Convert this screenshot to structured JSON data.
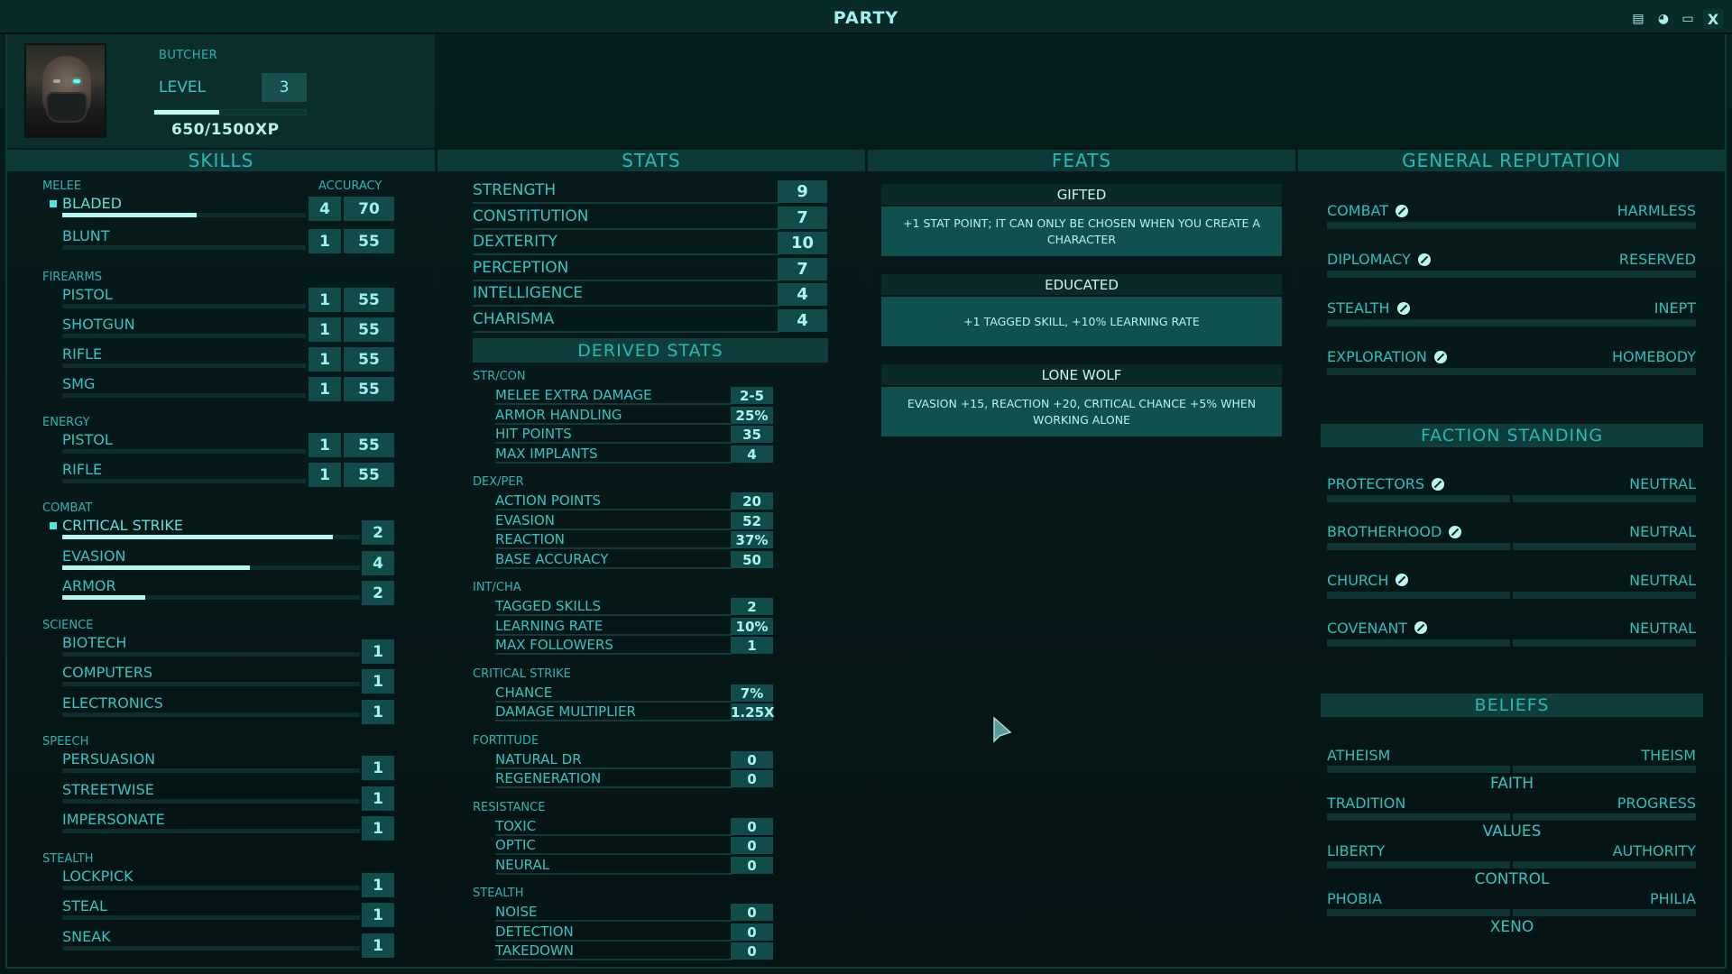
{
  "window": {
    "title": "PARTY",
    "buttons": [
      {
        "name": "inventory-icon",
        "glyph": "▤"
      },
      {
        "name": "character-head-icon",
        "glyph": "◕"
      },
      {
        "name": "monitor-icon",
        "glyph": "▭"
      },
      {
        "name": "close-icon",
        "glyph": "X"
      }
    ]
  },
  "character": {
    "name": "BUTCHER",
    "level_label": "LEVEL",
    "level": "3",
    "xp_current": 650,
    "xp_max": 1500,
    "xp_text": "650/1500XP",
    "xp_fraction": 0.43
  },
  "columns": {
    "skills": "SKILLS",
    "stats": "STATS",
    "feats": "FEATS",
    "reputation": "GENERAL REPUTATION"
  },
  "skills": {
    "accuracy_label": "ACCURACY",
    "groups": [
      {
        "label": "MELEE",
        "items": [
          {
            "name": "BLADED",
            "tagged": true,
            "level": "4",
            "accuracy": "70",
            "progress": 0.55
          },
          {
            "name": "BLUNT",
            "tagged": false,
            "level": "1",
            "accuracy": "55",
            "progress": 0
          }
        ]
      },
      {
        "label": "FIREARMS",
        "items": [
          {
            "name": "PISTOL",
            "tagged": false,
            "level": "1",
            "accuracy": "55",
            "progress": 0
          },
          {
            "name": "SHOTGUN",
            "tagged": false,
            "level": "1",
            "accuracy": "55",
            "progress": 0
          },
          {
            "name": "RIFLE",
            "tagged": false,
            "level": "1",
            "accuracy": "55",
            "progress": 0
          },
          {
            "name": "SMG",
            "tagged": false,
            "level": "1",
            "accuracy": "55",
            "progress": 0
          }
        ]
      },
      {
        "label": "ENERGY",
        "items": [
          {
            "name": "PISTOL",
            "tagged": false,
            "level": "1",
            "accuracy": "55",
            "progress": 0
          },
          {
            "name": "RIFLE",
            "tagged": false,
            "level": "1",
            "accuracy": "55",
            "progress": 0
          }
        ]
      },
      {
        "label": "COMBAT",
        "items": [
          {
            "name": "CRITICAL STRIKE",
            "tagged": true,
            "level": "2",
            "progress": 0.91
          },
          {
            "name": "EVASION",
            "tagged": false,
            "level": "4",
            "progress": 0.63
          },
          {
            "name": "ARMOR",
            "tagged": false,
            "level": "2",
            "progress": 0.28
          }
        ]
      },
      {
        "label": "SCIENCE",
        "items": [
          {
            "name": "BIOTECH",
            "tagged": false,
            "level": "1",
            "progress": 0
          },
          {
            "name": "COMPUTERS",
            "tagged": false,
            "level": "1",
            "progress": 0
          },
          {
            "name": "ELECTRONICS",
            "tagged": false,
            "level": "1",
            "progress": 0
          }
        ]
      },
      {
        "label": "SPEECH",
        "items": [
          {
            "name": "PERSUASION",
            "tagged": false,
            "level": "1",
            "progress": 0
          },
          {
            "name": "STREETWISE",
            "tagged": false,
            "level": "1",
            "progress": 0
          },
          {
            "name": "IMPERSONATE",
            "tagged": false,
            "level": "1",
            "progress": 0
          }
        ]
      },
      {
        "label": "STEALTH",
        "items": [
          {
            "name": "LOCKPICK",
            "tagged": false,
            "level": "1",
            "progress": 0
          },
          {
            "name": "STEAL",
            "tagged": false,
            "level": "1",
            "progress": 0
          },
          {
            "name": "SNEAK",
            "tagged": false,
            "level": "1",
            "progress": 0
          }
        ]
      }
    ]
  },
  "stats": {
    "primary": [
      {
        "name": "STRENGTH",
        "value": "9"
      },
      {
        "name": "CONSTITUTION",
        "value": "7"
      },
      {
        "name": "DEXTERITY",
        "value": "10"
      },
      {
        "name": "PERCEPTION",
        "value": "7"
      },
      {
        "name": "INTELLIGENCE",
        "value": "4"
      },
      {
        "name": "CHARISMA",
        "value": "4"
      }
    ],
    "derived_title": "DERIVED STATS",
    "derived_groups": [
      {
        "label": "STR/CON",
        "items": [
          {
            "name": "MELEE EXTRA DAMAGE",
            "value": "2-5"
          },
          {
            "name": "ARMOR HANDLING",
            "value": "25%"
          },
          {
            "name": "HIT POINTS",
            "value": "35"
          },
          {
            "name": "MAX IMPLANTS",
            "value": "4"
          }
        ]
      },
      {
        "label": "DEX/PER",
        "items": [
          {
            "name": "ACTION POINTS",
            "value": "20"
          },
          {
            "name": "EVASION",
            "value": "52"
          },
          {
            "name": "REACTION",
            "value": "37%"
          },
          {
            "name": "BASE ACCURACY",
            "value": "50"
          }
        ]
      },
      {
        "label": "INT/CHA",
        "items": [
          {
            "name": "TAGGED SKILLS",
            "value": "2"
          },
          {
            "name": "LEARNING RATE",
            "value": "10%"
          },
          {
            "name": "MAX FOLLOWERS",
            "value": "1"
          }
        ]
      },
      {
        "label": "CRITICAL STRIKE",
        "items": [
          {
            "name": "CHANCE",
            "value": "7%"
          },
          {
            "name": "DAMAGE MULTIPLIER",
            "value": "1.25x"
          }
        ]
      },
      {
        "label": "FORTITUDE",
        "items": [
          {
            "name": "NATURAL DR",
            "value": "0"
          },
          {
            "name": "REGENERATION",
            "value": "0"
          }
        ]
      },
      {
        "label": "RESISTANCE",
        "items": [
          {
            "name": "TOXIC",
            "value": "0"
          },
          {
            "name": "OPTIC",
            "value": "0"
          },
          {
            "name": "NEURAL",
            "value": "0"
          }
        ]
      },
      {
        "label": "STEALTH",
        "items": [
          {
            "name": "NOISE",
            "value": "0"
          },
          {
            "name": "DETECTION",
            "value": "0"
          },
          {
            "name": "TAKEDOWN",
            "value": "0"
          }
        ]
      }
    ]
  },
  "feats": [
    {
      "title": "GIFTED",
      "description": "+1 STAT POINT; IT CAN ONLY BE CHOSEN WHEN YOU CREATE A CHARACTER"
    },
    {
      "title": "EDUCATED",
      "description": "+1 TAGGED SKILL, +10% LEARNING RATE"
    },
    {
      "title": "LONE WOLF",
      "description": "EVASION +15, REACTION +20, CRITICAL CHANCE +5% WHEN WORKING ALONE"
    }
  ],
  "reputation": {
    "general": [
      {
        "name": "COMBAT",
        "points": "0",
        "rank": "HARMLESS"
      },
      {
        "name": "DIPLOMACY",
        "points": "0",
        "rank": "RESERVED"
      },
      {
        "name": "STEALTH",
        "points": "0",
        "rank": "INEPT"
      },
      {
        "name": "EXPLORATION",
        "points": "0",
        "rank": "HOMEBODY"
      }
    ],
    "faction_title": "FACTION STANDING",
    "factions": [
      {
        "name": "PROTECTORS",
        "points": "0",
        "standing": "NEUTRAL"
      },
      {
        "name": "BROTHERHOOD",
        "points": "0",
        "standing": "NEUTRAL"
      },
      {
        "name": "CHURCH",
        "points": "0",
        "standing": "NEUTRAL"
      },
      {
        "name": "COVENANT",
        "points": "0",
        "standing": "NEUTRAL"
      }
    ],
    "beliefs_title": "BELIEFS",
    "beliefs": [
      {
        "left": "ATHEISM",
        "right": "THEISM",
        "axis": "FAITH"
      },
      {
        "left": "TRADITION",
        "right": "PROGRESS",
        "axis": "VALUES"
      },
      {
        "left": "LIBERTY",
        "right": "AUTHORITY",
        "axis": "CONTROL"
      },
      {
        "left": "PHOBIA",
        "right": "PHILIA",
        "axis": "XENO"
      }
    ]
  },
  "colors": {
    "accent": "#2fbfbd",
    "highlight": "#b6f4f1",
    "box": "#124c4a",
    "header_bar": "#0d3a39"
  }
}
